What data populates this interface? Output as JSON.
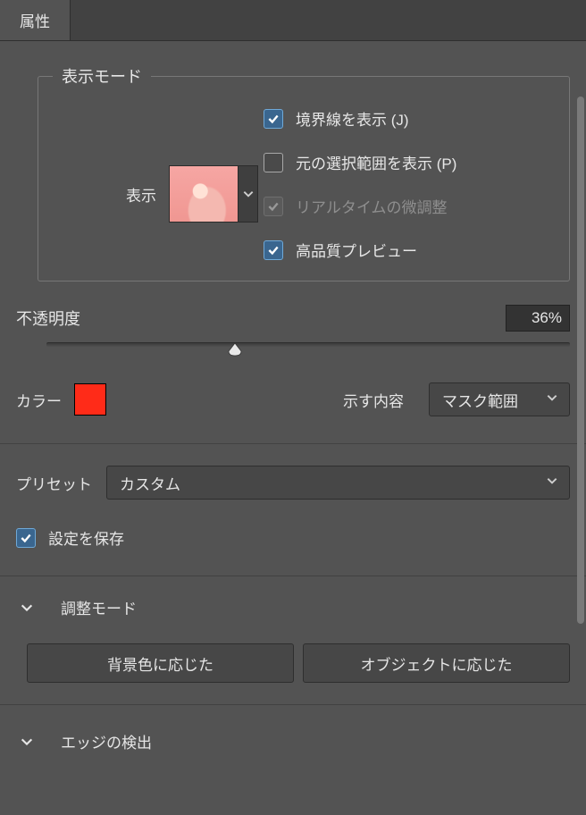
{
  "tab_title": "属性",
  "display_mode": {
    "legend": "表示モード",
    "display_label": "表示",
    "checks": {
      "show_edge": {
        "label": "境界線を表示 (J)",
        "checked": true,
        "disabled": false
      },
      "show_original": {
        "label": "元の選択範囲を表示 (P)",
        "checked": false,
        "disabled": false
      },
      "realtime": {
        "label": "リアルタイムの微調整",
        "checked": true,
        "disabled": true
      },
      "hq_preview": {
        "label": "高品質プレビュー",
        "checked": true,
        "disabled": false
      }
    }
  },
  "opacity": {
    "label": "不透明度",
    "value": "36%",
    "percent": 36
  },
  "color_label": "カラー",
  "color_hex": "#ff2b18",
  "show_content": {
    "label": "示す内容",
    "value": "マスク範囲"
  },
  "preset": {
    "label": "プリセット",
    "value": "カスタム"
  },
  "save_settings": {
    "label": "設定を保存",
    "checked": true
  },
  "adjust_mode": {
    "title": "調整モード",
    "bg_btn": "背景色に応じた",
    "obj_btn": "オブジェクトに応じた"
  },
  "edge_detect": {
    "title": "エッジの検出"
  }
}
